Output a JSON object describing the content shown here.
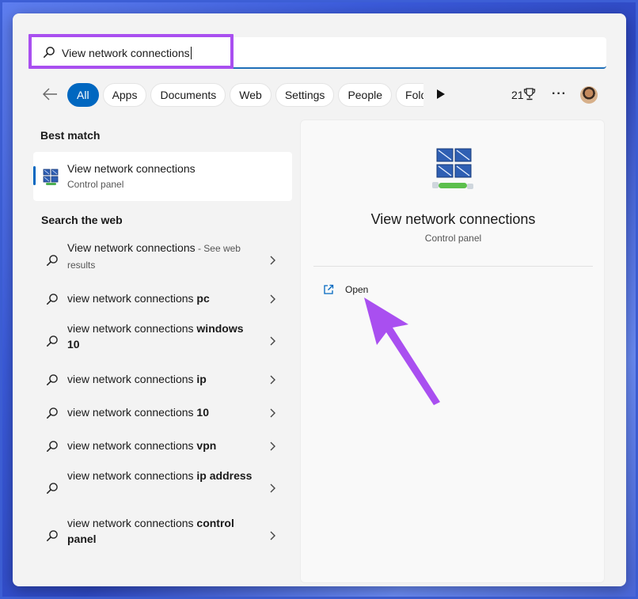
{
  "search": {
    "value": "View network connections"
  },
  "filters": {
    "chips": [
      "All",
      "Apps",
      "Documents",
      "Web",
      "Settings",
      "People",
      "Folde"
    ],
    "active_index": 0,
    "reward_count": "21"
  },
  "left": {
    "best_match_heading": "Best match",
    "best_match": {
      "title": "View network connections",
      "subtitle": "Control panel"
    },
    "search_web_heading": "Search the web",
    "web_results": [
      {
        "prefix": "View network connections",
        "bold": "",
        "suffix": " - See web results"
      },
      {
        "prefix": "view network connections ",
        "bold": "pc",
        "suffix": ""
      },
      {
        "prefix": "view network connections ",
        "bold": "windows 10",
        "suffix": ""
      },
      {
        "prefix": "view network connections ",
        "bold": "ip",
        "suffix": ""
      },
      {
        "prefix": "view network connections ",
        "bold": "10",
        "suffix": ""
      },
      {
        "prefix": "view network connections ",
        "bold": "vpn",
        "suffix": ""
      },
      {
        "prefix": "view network connections ",
        "bold": "ip address",
        "suffix": ""
      },
      {
        "prefix": "view network connections ",
        "bold": "control panel",
        "suffix": ""
      }
    ]
  },
  "right": {
    "title": "View network connections",
    "subtitle": "Control panel",
    "open_label": "Open"
  },
  "colors": {
    "accent": "#0067c0",
    "highlight": "#a94ff0",
    "arrow": "#a94ff0"
  },
  "icons": [
    "search-icon",
    "back-arrow-icon",
    "play-icon",
    "trophy-icon",
    "more-icon",
    "network-connections-icon",
    "chevron-right-icon",
    "open-external-icon"
  ]
}
